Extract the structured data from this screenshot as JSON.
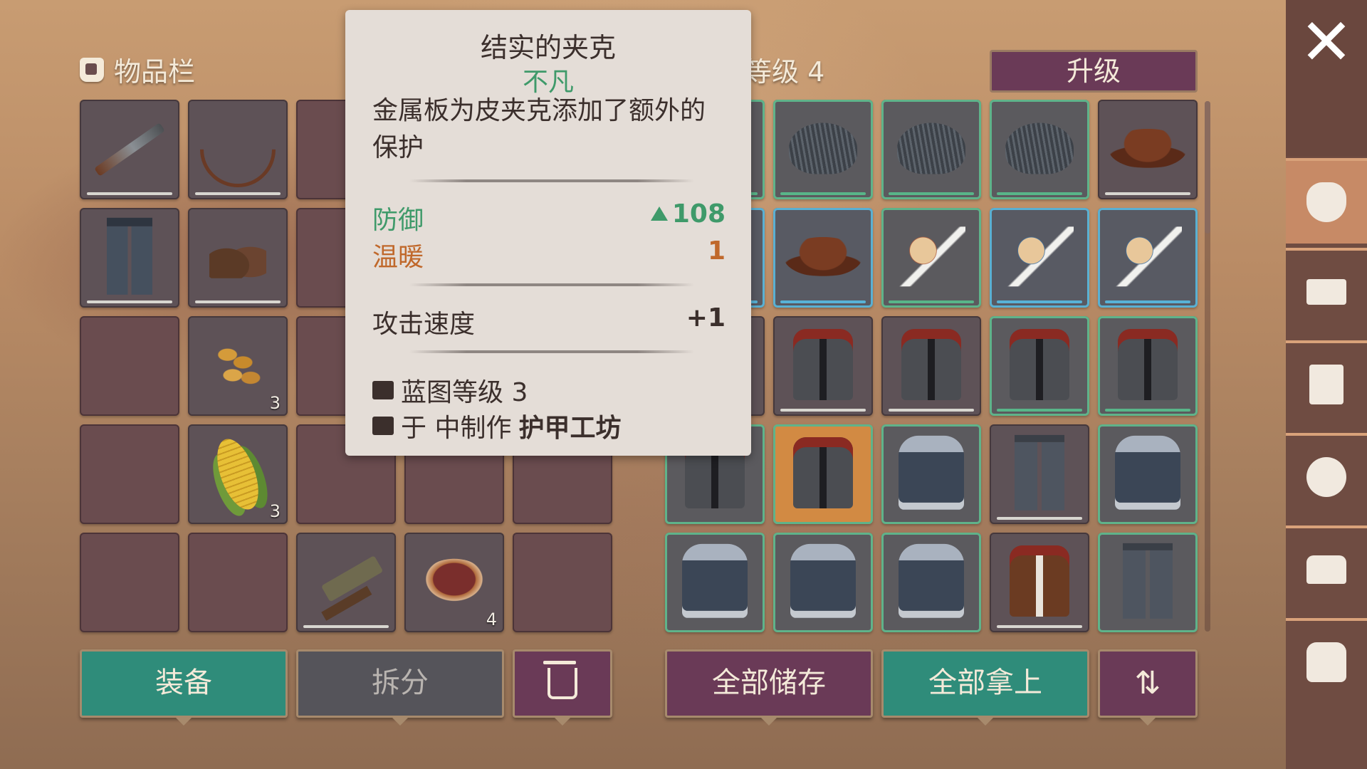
{
  "inventory": {
    "title": "物品栏",
    "slots": [
      {
        "icon": "rifle-icon",
        "durability": "full"
      },
      {
        "icon": "bow-icon",
        "durability": "full"
      },
      {
        "icon": ""
      },
      {
        "icon": "jeans-icon",
        "durability": "full"
      },
      {
        "icon": "boots-icon",
        "durability": "full"
      },
      {
        "icon": ""
      },
      {
        "icon": ""
      },
      {
        "icon": "seeds-icon",
        "qty": "3"
      },
      {
        "icon": ""
      },
      {
        "icon": ""
      },
      {
        "icon": "corn-icon",
        "qty": "3"
      },
      {
        "icon": ""
      },
      {
        "icon": ""
      },
      {
        "icon": ""
      },
      {
        "icon": "pistol-icon",
        "durability": "full"
      },
      {
        "icon": "meat-icon",
        "qty": "4"
      },
      {
        "icon": ""
      }
    ]
  },
  "tooltip": {
    "title": "结实的夹克",
    "rarity": "不凡",
    "description": "金属板为皮夹克添加了额外的保护",
    "stats": [
      {
        "label": "防御",
        "value": "108",
        "color": "#3f9a6a",
        "arrow": true
      },
      {
        "label": "温暖",
        "value": "1",
        "color": "#c0682b"
      }
    ],
    "attack_speed": {
      "label": "攻击速度",
      "value": "+1"
    },
    "blueprint": "蓝图等级 3",
    "craft_prefix": "于 中制作",
    "craft_station": "护甲工坊"
  },
  "storage": {
    "level_label": "等级 4",
    "upgrade_label": "升级"
  },
  "buttons": {
    "equip": "装备",
    "split": "拆分",
    "store_all": "全部储存",
    "take_all": "全部拿上"
  },
  "colors": {
    "rarity_green": "#5fb38a",
    "rarity_blue": "#5ab0d2",
    "selected_orange": "#d28a43",
    "button_teal": "#2f8c7a",
    "button_plum": "#6a3a57"
  },
  "sidebar": {
    "close": "✕",
    "tabs": [
      "sack-icon",
      "workbench-icon",
      "quest-icon",
      "money-icon",
      "anvil-icon",
      "backpack-icon"
    ]
  }
}
